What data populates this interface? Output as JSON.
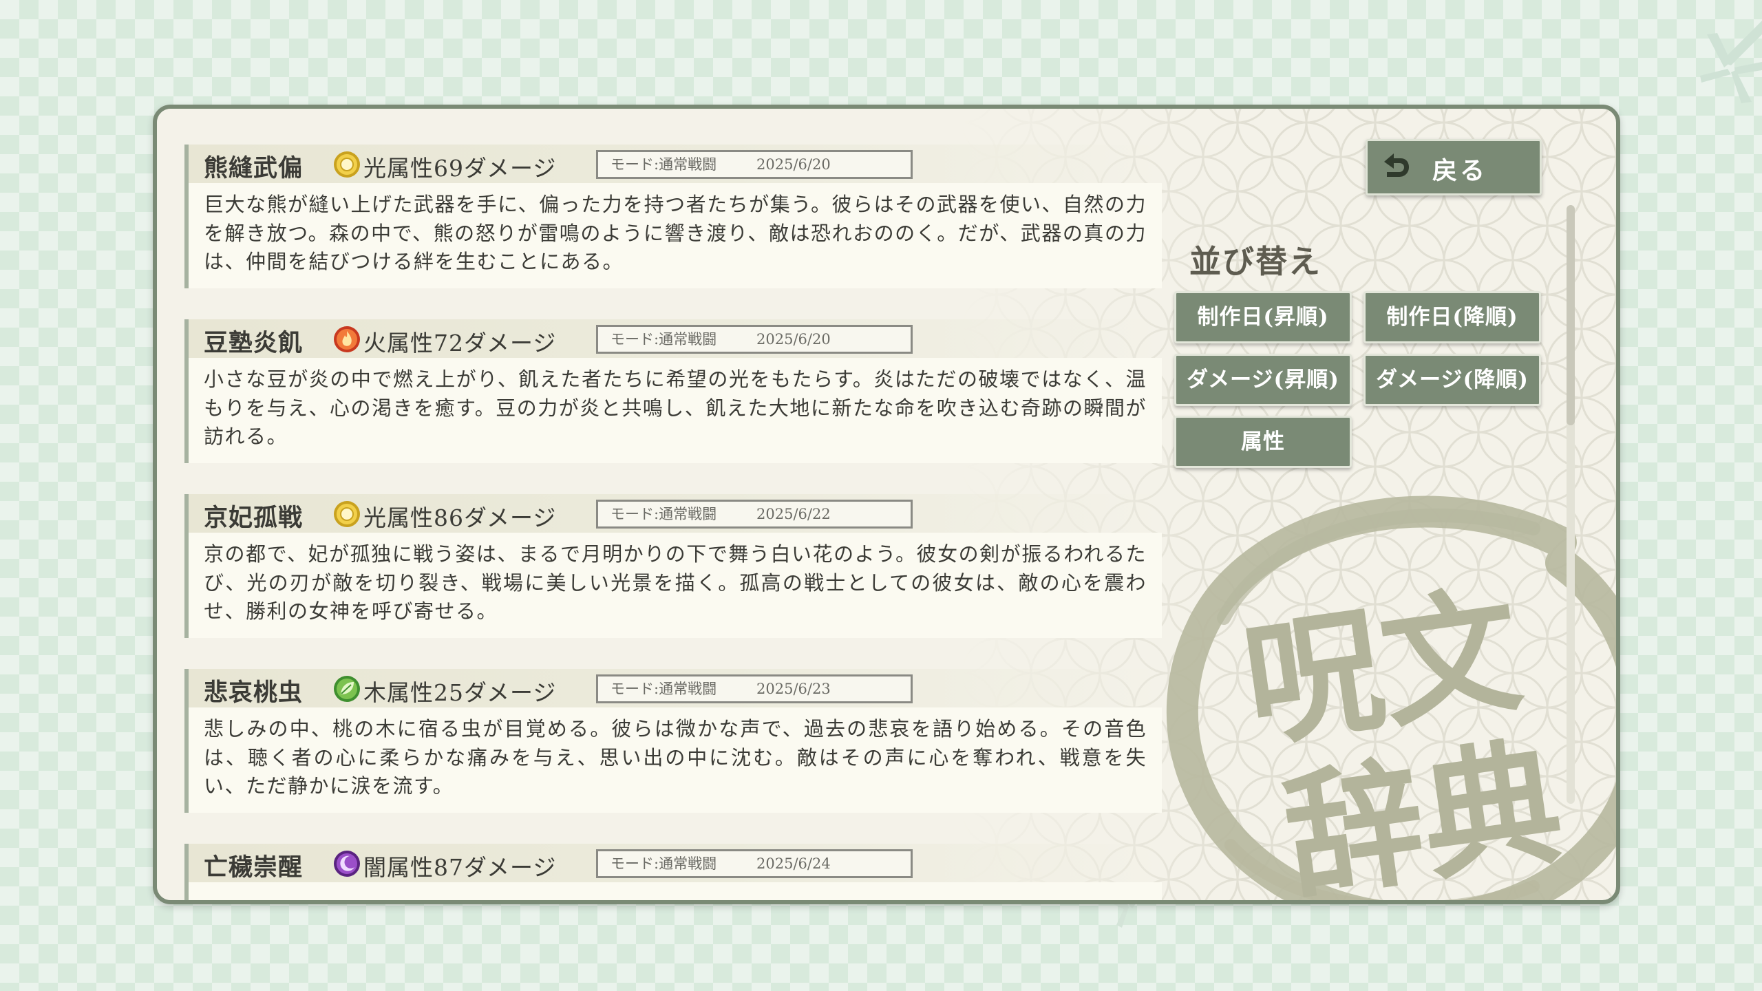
{
  "seal": {
    "line1": "呪文",
    "line2": "辞典"
  },
  "back_button": {
    "label": "戻る",
    "icon": "return-arrow-icon"
  },
  "sort": {
    "title": "並び替え",
    "buttons": {
      "date_asc": "制作日(昇順)",
      "date_desc": "制作日(降順)",
      "damage_asc": "ダメージ(昇順)",
      "damage_desc": "ダメージ(降順)",
      "attribute": "属性"
    }
  },
  "entries": [
    {
      "name": "熊縫武偏",
      "attribute_icon": "light",
      "attribute": "光属性69ダメージ",
      "mode": "モード:通常戦闘",
      "date": "2025/6/20",
      "description": "巨大な熊が縫い上げた武器を手に、偏った力を持つ者たちが集う。彼らはその武器を使い、自然の力を解き放つ。森の中で、熊の怒りが雷鳴のように響き渡り、敵は恐れおののく。だが、武器の真の力は、仲間を結びつける絆を生むことにある。"
    },
    {
      "name": "豆塾炎飢",
      "attribute_icon": "fire",
      "attribute": "火属性72ダメージ",
      "mode": "モード:通常戦闘",
      "date": "2025/6/20",
      "description": "小さな豆が炎の中で燃え上がり、飢えた者たちに希望の光をもたらす。炎はただの破壊ではなく、温もりを与え、心の渇きを癒す。豆の力が炎と共鳴し、飢えた大地に新たな命を吹き込む奇跡の瞬間が訪れる。"
    },
    {
      "name": "京妃孤戦",
      "attribute_icon": "light",
      "attribute": "光属性86ダメージ",
      "mode": "モード:通常戦闘",
      "date": "2025/6/22",
      "description": "京の都で、妃が孤独に戦う姿は、まるで月明かりの下で舞う白い花のよう。彼女の剣が振るわれるたび、光の刃が敵を切り裂き、戦場に美しい光景を描く。孤高の戦士としての彼女は、敵の心を震わせ、勝利の女神を呼び寄せる。"
    },
    {
      "name": "悲哀桃虫",
      "attribute_icon": "wood",
      "attribute": "木属性25ダメージ",
      "mode": "モード:通常戦闘",
      "date": "2025/6/23",
      "description": "悲しみの中、桃の木に宿る虫が目覚める。彼らは微かな声で、過去の悲哀を語り始める。その音色は、聴く者の心に柔らかな痛みを与え、思い出の中に沈む。敵はその声に心を奪われ、戦意を失い、ただ静かに涙を流す。"
    },
    {
      "name": "亡穢崇醒",
      "attribute_icon": "dark",
      "attribute": "闇属性87ダメージ",
      "mode": "モード:通常戦闘",
      "date": "2025/6/24",
      "description": ""
    }
  ]
}
